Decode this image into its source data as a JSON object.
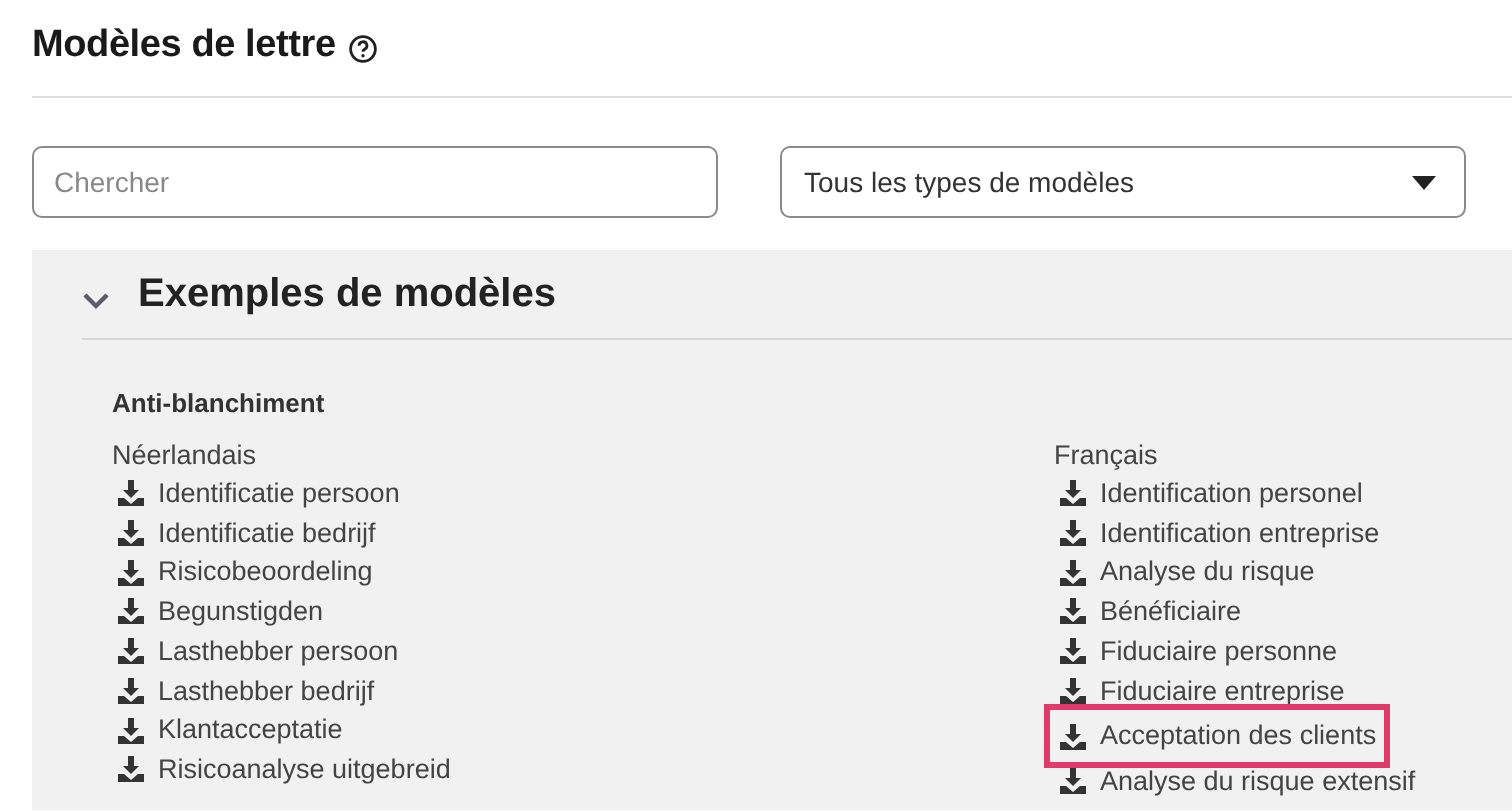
{
  "page": {
    "title": "Modèles de lettre"
  },
  "search": {
    "placeholder": "Chercher"
  },
  "type_select": {
    "value": "Tous les types de modèles"
  },
  "section": {
    "title": "Exemples de modèles",
    "expanded": true,
    "group": "Anti-blanchiment",
    "columns": [
      {
        "language": "Néerlandais",
        "items": [
          {
            "label": "Identificatie persoon",
            "highlighted": false
          },
          {
            "label": "Identificatie bedrijf",
            "highlighted": false
          },
          {
            "label": "Risicobeoordeling",
            "highlighted": false
          },
          {
            "label": "Begunstigden",
            "highlighted": false
          },
          {
            "label": "Lasthebber persoon",
            "highlighted": false
          },
          {
            "label": "Lasthebber bedrijf",
            "highlighted": false
          },
          {
            "label": "Klantacceptatie",
            "highlighted": false
          },
          {
            "label": "Risicoanalyse uitgebreid",
            "highlighted": false
          }
        ]
      },
      {
        "language": "Français",
        "items": [
          {
            "label": "Identification personel",
            "highlighted": false
          },
          {
            "label": "Identification entreprise",
            "highlighted": false
          },
          {
            "label": "Analyse du risque",
            "highlighted": false
          },
          {
            "label": "Bénéficiaire",
            "highlighted": false
          },
          {
            "label": "Fiduciaire personne",
            "highlighted": false
          },
          {
            "label": "Fiduciaire entreprise",
            "highlighted": false
          },
          {
            "label": "Acceptation des clients",
            "highlighted": true
          },
          {
            "label": "Analyse du risque extensif",
            "highlighted": false
          }
        ]
      }
    ]
  }
}
